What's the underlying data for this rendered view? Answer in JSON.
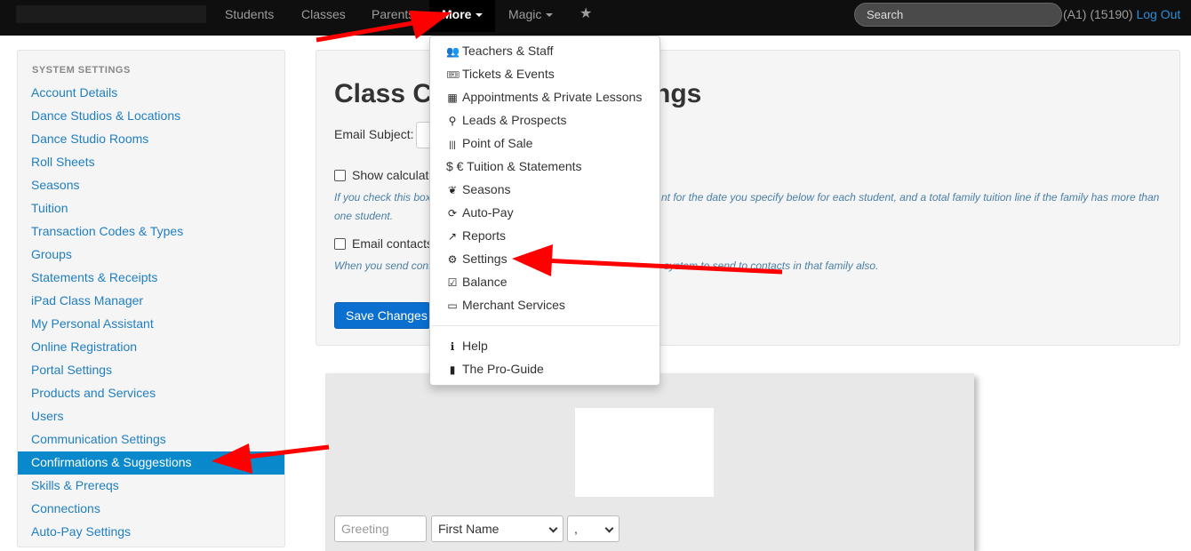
{
  "navbar": {
    "items": [
      {
        "label": "Students"
      },
      {
        "label": "Classes"
      },
      {
        "label": "Parents"
      },
      {
        "label": "More"
      },
      {
        "label": "Magic"
      }
    ],
    "star_icon": "star-icon",
    "search_placeholder": "Search",
    "user_code": "(A1) (15190)",
    "logout_label": "Log Out"
  },
  "sidebar": {
    "header": "SYSTEM SETTINGS",
    "items": [
      {
        "label": "Account Details"
      },
      {
        "label": "Dance Studios & Locations"
      },
      {
        "label": "Dance Studio Rooms"
      },
      {
        "label": "Roll Sheets"
      },
      {
        "label": "Seasons"
      },
      {
        "label": "Tuition"
      },
      {
        "label": "Transaction Codes & Types"
      },
      {
        "label": "Groups"
      },
      {
        "label": "Statements & Receipts"
      },
      {
        "label": "iPad Class Manager"
      },
      {
        "label": "My Personal Assistant"
      },
      {
        "label": "Online Registration"
      },
      {
        "label": "Portal Settings"
      },
      {
        "label": "Products and Services"
      },
      {
        "label": "Users"
      },
      {
        "label": "Communication Settings"
      },
      {
        "label": "Confirmations & Suggestions"
      },
      {
        "label": "Skills & Prereqs"
      },
      {
        "label": "Connections"
      },
      {
        "label": "Auto-Pay Settings"
      }
    ],
    "active_color": "#0988cc"
  },
  "main": {
    "title_start": "Class C",
    "title_end": "ngs",
    "email_subject_label": "Email Subject:",
    "checkbox1_label": "Show calculate",
    "help1_line1_start": "If you check this box",
    "help1_line1_end": "nt for the date you specify below for each student, and a total family tuition line if the family has more than",
    "help1_line2": "one student.",
    "checkbox2_label": "Email contacts",
    "help2_start": "When you send cont",
    "help2_end": "system to send to contacts in that family also.",
    "save_label": "Save Changes"
  },
  "preview": {
    "greeting_placeholder": "Greeting",
    "first_name_select": "First Name",
    "punct_select": ","
  },
  "dropdown": {
    "items": [
      {
        "label": "Teachers & Staff",
        "icon": "users-icon",
        "glyph": "👥"
      },
      {
        "label": "Tickets & Events",
        "icon": "ticket-icon",
        "glyph": "🎟"
      },
      {
        "label": "Appointments & Private Lessons",
        "icon": "calendar-icon",
        "glyph": "▦"
      },
      {
        "label": "Leads & Prospects",
        "icon": "map-marker-icon",
        "glyph": "⚲"
      },
      {
        "label": "Point of Sale",
        "icon": "barcode-icon",
        "glyph": "|||"
      },
      {
        "label": "$ € Tuition & Statements",
        "icon": "currency-icon",
        "glyph": ""
      },
      {
        "label": "Seasons",
        "icon": "leaf-icon",
        "glyph": "❦"
      },
      {
        "label": "Auto-Pay",
        "icon": "refresh-icon",
        "glyph": "⟳"
      },
      {
        "label": "Reports",
        "icon": "line-chart-icon",
        "glyph": "↗"
      },
      {
        "label": "Settings",
        "icon": "cogs-icon",
        "glyph": "⚙"
      },
      {
        "label": "Balance",
        "icon": "check-square-icon",
        "glyph": "☑"
      },
      {
        "label": "Merchant Services",
        "icon": "visa-card-icon",
        "glyph": "▭"
      },
      {
        "label": "Help",
        "icon": "info-circle-icon",
        "glyph": "ℹ"
      },
      {
        "label": "The Pro-Guide",
        "icon": "book-icon",
        "glyph": "▮"
      }
    ]
  },
  "annotations": {
    "arrow_color": "#ff0000"
  }
}
